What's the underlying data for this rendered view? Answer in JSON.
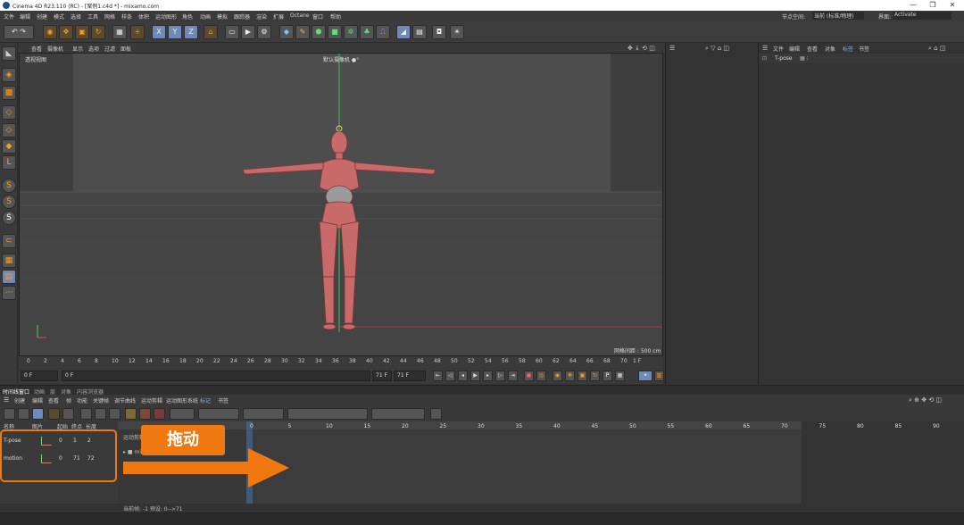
{
  "window": {
    "title": "Cinema 4D R23.110 (RC) - [案例1.c4d *] - mixamo.com",
    "controls": [
      "—",
      "❐",
      "✕"
    ]
  },
  "menubar": {
    "items": [
      "文件",
      "编辑",
      "创建",
      "模式",
      "选择",
      "工具",
      "网格",
      "样条",
      "体积",
      "运动图形",
      "角色",
      "动画",
      "模拟",
      "跟踪器",
      "渲染",
      "扩展",
      "Octane",
      "窗口",
      "帮助"
    ],
    "node_space_label": "节点空间:",
    "node_space_value": "当前 (标准/物理)",
    "layout_label": "界面:",
    "layout_value": "Activate"
  },
  "viewport": {
    "menu": [
      "查看",
      "摄像机",
      "显示",
      "选项",
      "过滤",
      "面板"
    ],
    "view_name": "透视视图",
    "camera_label": "默认摄像机 ●°",
    "grid_distance": "网格间距 : 500 cm"
  },
  "ruler": {
    "ticks": [
      "0",
      "2",
      "4",
      "6",
      "8",
      "10",
      "12",
      "14",
      "16",
      "18",
      "20",
      "22",
      "24",
      "26",
      "28",
      "30",
      "32",
      "34",
      "36",
      "38",
      "40",
      "42",
      "44",
      "46",
      "48",
      "50",
      "52",
      "54",
      "56",
      "58",
      "60",
      "62",
      "64",
      "66",
      "68",
      "70"
    ],
    "end_frame": "1 F"
  },
  "playback": {
    "current": "0 F",
    "start": "0 F",
    "end_a": "71 F",
    "end_b": "71 F"
  },
  "right_panel": {
    "menu": [
      "文件",
      "编辑",
      "查看",
      "对象",
      "标签",
      "书签"
    ],
    "object_name": "T-pose"
  },
  "timeline": {
    "tabs": [
      "时间线窗口",
      "动画",
      "层",
      "对象",
      "内容浏览器"
    ],
    "menu": [
      "创建",
      "编辑",
      "查看",
      "帧",
      "功能",
      "关键帧",
      "调节曲线",
      "运动剪辑",
      "运动图形系统",
      "标记",
      "书签"
    ],
    "headers": [
      "名称",
      "图片",
      "起始",
      "终点",
      "长度"
    ],
    "rows": [
      {
        "name": "T-pose",
        "start": "0",
        "end": "1",
        "length": "2"
      },
      {
        "name": "motion",
        "start": "0",
        "end": "71",
        "length": "72"
      }
    ],
    "graph_ticks": [
      "0",
      "5",
      "10",
      "15",
      "20",
      "25",
      "30",
      "35",
      "40",
      "45",
      "50",
      "55",
      "60",
      "65",
      "70",
      "75",
      "80",
      "85",
      "90"
    ],
    "clip_label": "运动剪辑",
    "status": "当前帧: -1  预设: 0-->71"
  },
  "annotation": {
    "label": "拖动",
    "color": "#f07810"
  }
}
